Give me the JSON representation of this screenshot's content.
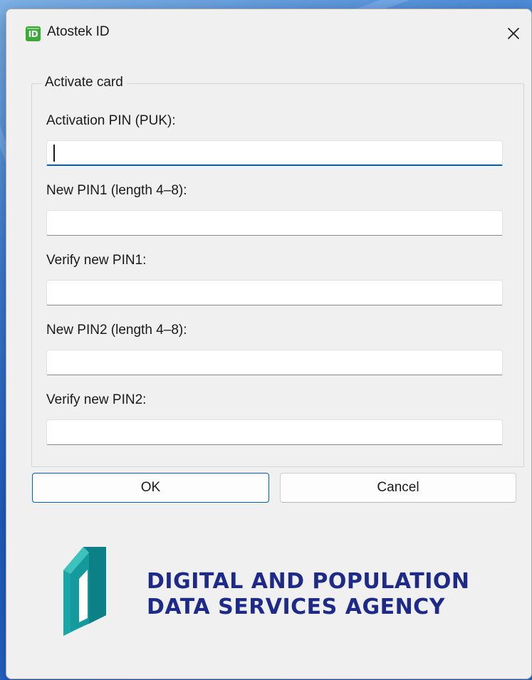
{
  "window": {
    "title": "Atostek ID",
    "app_icon_text": "ID",
    "close_icon": "close-icon"
  },
  "form": {
    "group_label": "Activate card",
    "fields": [
      {
        "label": "Activation PIN (PUK):",
        "value": "",
        "focused": true
      },
      {
        "label": "New PIN1 (length 4–8):",
        "value": "",
        "focused": false
      },
      {
        "label": "Verify new PIN1:",
        "value": "",
        "focused": false
      },
      {
        "label": "New PIN2 (length 4–8):",
        "value": "",
        "focused": false
      },
      {
        "label": "Verify new PIN2:",
        "value": "",
        "focused": false
      }
    ]
  },
  "buttons": {
    "ok_label": "OK",
    "cancel_label": "Cancel"
  },
  "branding": {
    "line1": "DIGITAL AND POPULATION",
    "line2": "DATA SERVICES AGENCY",
    "logo_icon": "dvv-logo-icon"
  },
  "colors": {
    "accent": "#005fb8",
    "brand_text": "#1e2a87",
    "logo_teal": "#1aa6a6",
    "app_icon_green": "#3aa935"
  }
}
